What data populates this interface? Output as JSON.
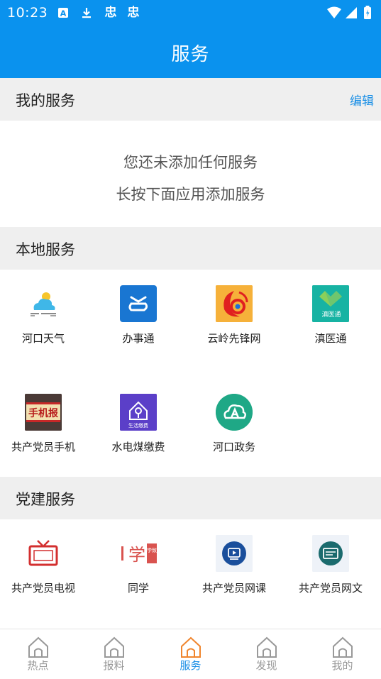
{
  "status_bar": {
    "time": "10:23",
    "notif_glyph_1": "忠",
    "notif_glyph_2": "忠"
  },
  "header": {
    "title": "服务"
  },
  "my_services": {
    "title": "我的服务",
    "edit_label": "编辑",
    "empty_line1": "您还未添加任何服务",
    "empty_line2": "长按下面应用添加服务"
  },
  "local_services": {
    "title": "本地服务",
    "items": [
      {
        "label": "河口天气",
        "icon": "weather-icon"
      },
      {
        "label": "办事通",
        "icon": "banshitong-icon"
      },
      {
        "label": "云岭先锋网",
        "icon": "yunling-icon"
      },
      {
        "label": "滇医通",
        "icon": "dianyitong-icon"
      },
      {
        "label": "共产党员手机",
        "icon": "phone-newspaper-icon"
      },
      {
        "label": "水电煤缴费",
        "icon": "utility-payment-icon"
      },
      {
        "label": "河口政务",
        "icon": "government-cloud-icon"
      }
    ],
    "icon_texts": {
      "dianyitong": "滇医通",
      "newspaper": "手机报",
      "utility": "生活缴费",
      "tongxue": "学",
      "tongxue_tag": "学致"
    }
  },
  "party_services": {
    "title": "党建服务",
    "items": [
      {
        "label": "共产党员电视",
        "icon": "tv-icon"
      },
      {
        "label": "同学",
        "icon": "tongxue-icon"
      },
      {
        "label": "共产党员网课",
        "icon": "video-course-icon"
      },
      {
        "label": "共产党员网文",
        "icon": "article-icon"
      }
    ]
  },
  "bottom_nav": {
    "items": [
      {
        "label": "热点",
        "active": false
      },
      {
        "label": "报料",
        "active": false
      },
      {
        "label": "服务",
        "active": true
      },
      {
        "label": "发现",
        "active": false
      },
      {
        "label": "我的",
        "active": false
      }
    ]
  },
  "colors": {
    "primary": "#0A92EE",
    "accent_text": "#1A8FE6",
    "nav_active": "#F0852D",
    "nav_inactive": "#999999",
    "section_bg": "#EFEFEF"
  }
}
